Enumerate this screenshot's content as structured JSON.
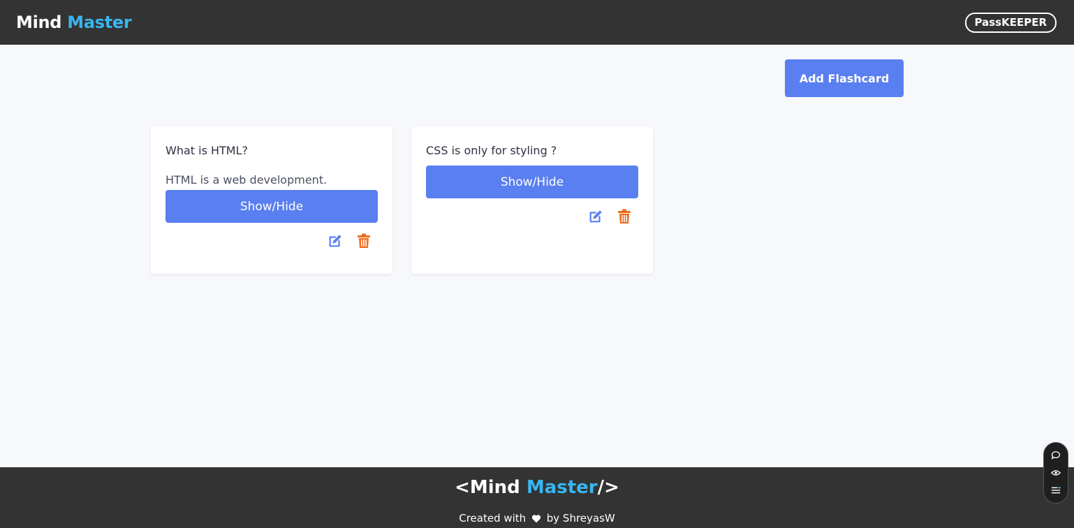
{
  "navbar": {
    "brand_part1": "Mind",
    "brand_part2": "Master",
    "right_link": "PassKEEPER"
  },
  "actions": {
    "add_label": "Add Flashcard"
  },
  "cards": [
    {
      "question": "What is HTML?",
      "answer": "HTML is a web development.",
      "toggle_label": "Show/Hide",
      "edit_icon": "edit-icon",
      "delete_icon": "trash-icon"
    },
    {
      "question": "CSS is only for styling ?",
      "toggle_label": "Show/Hide",
      "edit_icon": "edit-icon",
      "delete_icon": "trash-icon"
    }
  ],
  "footer": {
    "brand_open": "<",
    "brand_part1": "Mind",
    "brand_part2": "Master",
    "brand_close": "/>",
    "credit_prefix": "Created with",
    "credit_suffix": "by ShreyasW"
  },
  "widget": {
    "icons": [
      "chat-icon",
      "eye-icon",
      "menu-icon"
    ]
  },
  "colors": {
    "header_bg": "#333333",
    "accent_blue": "#38b6f0",
    "button_blue": "#5a7ff0",
    "edit_blue": "#5a7ff0",
    "delete_orange": "#f06a1d",
    "page_bg": "#f7f8fc"
  }
}
